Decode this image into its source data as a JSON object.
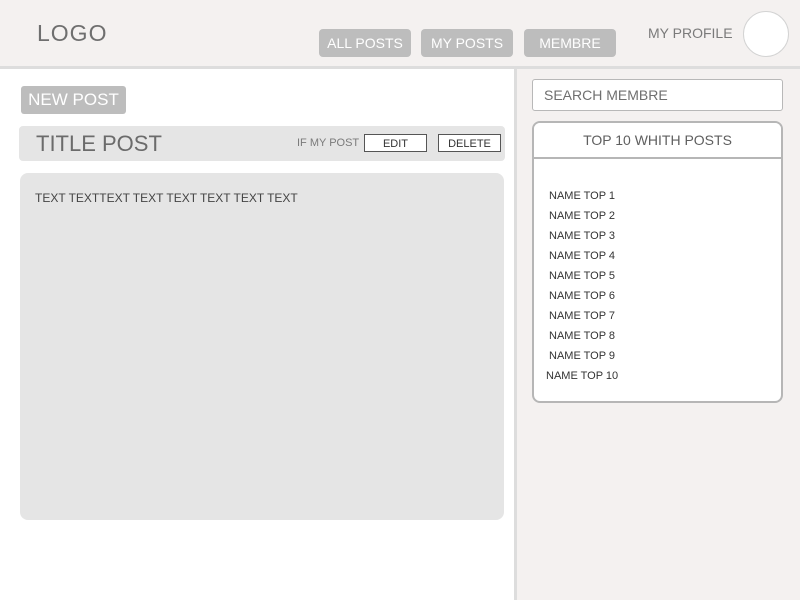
{
  "header": {
    "logo": "LOGO",
    "nav": {
      "all_posts": "ALL POSTS",
      "my_posts": "MY POSTS",
      "membre": "MEMBRE"
    },
    "profile_label": "MY PROFILE"
  },
  "main": {
    "new_post_label": "NEW POST",
    "post": {
      "title": "TITLE POST",
      "owner_hint": "IF MY POST",
      "edit_label": "EDIT",
      "delete_label": "DELETE",
      "body": "TEXT TEXTTEXT TEXT TEXT TEXT TEXT TEXT"
    }
  },
  "sidebar": {
    "search_placeholder": "SEARCH MEMBRE",
    "top_box_title": "TOP 10 WHITH POSTS",
    "top_list": [
      "NAME TOP 1",
      "NAME TOP 2",
      "NAME TOP 3",
      "NAME TOP 4",
      "NAME TOP 5",
      "NAME TOP 6",
      "NAME TOP 7",
      "NAME TOP 8",
      "NAME TOP 9",
      "NAME TOP 10"
    ]
  },
  "colors": {
    "header_bg": "#f4f1f0",
    "button_bg": "#bdbdbd",
    "panel_bg": "#e5e5e5"
  }
}
